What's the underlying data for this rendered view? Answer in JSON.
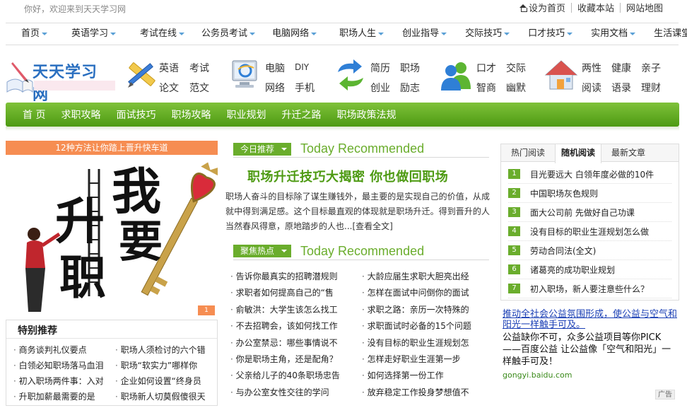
{
  "top": {
    "welcome": "你好，欢迎来到天天学习网",
    "links": [
      "设为首页",
      "收藏本站",
      "网站地图"
    ]
  },
  "nav": [
    "首页",
    "英语学习",
    "考试在线",
    "公务员考试",
    "电脑网络",
    "职场人生",
    "创业指导",
    "交际技巧",
    "口才技巧",
    "实用文档",
    "生活课堂"
  ],
  "brand": {
    "logo_text": "天天学习网",
    "groups": [
      {
        "icon": "pencil-ruler-icon",
        "words": [
          "英语",
          "考试",
          "论文",
          "范文"
        ]
      },
      {
        "icon": "computer-ie-icon",
        "words": [
          "电脑",
          "DIY",
          "网络",
          "手机"
        ]
      },
      {
        "icon": "refresh-arrows-icon",
        "words": [
          "简历",
          "职场",
          "创业",
          "励志"
        ]
      },
      {
        "icon": "people-icon",
        "words": [
          "口才",
          "交际",
          "智商",
          "幽默"
        ]
      },
      {
        "icon": "house-icon",
        "words": [
          "两性",
          "健康",
          "亲子",
          "阅读",
          "语录",
          "理财"
        ]
      }
    ]
  },
  "green_menu": [
    "首 页",
    "求职攻略",
    "面试技巧",
    "职场攻略",
    "职业规划",
    "升迁之路",
    "职场政策法规"
  ],
  "banner": {
    "title": "12种方法让你踏上晋升快车道",
    "chars": [
      "我",
      "要",
      "升",
      "职"
    ]
  },
  "special": {
    "title": "特别推荐",
    "items": [
      "商务谈判礼仪要点",
      "职场人须检讨的六个错",
      "白领必知职场落马血泪",
      "职场“软实力”哪样你",
      "初入职场两件事：入对",
      "企业如何设置“终身员",
      "升职加薪最需要的是",
      "职场新人切莫假傻很天"
    ]
  },
  "today": {
    "tag": "今日推荐",
    "en": "Today Recommended",
    "headline": "职场升迁技巧大揭密  你也做回职场",
    "summary": "职场人奋斗的目标除了谋生赚钱外，最主要的是实现自己的价值，从成就中得到满足感。这个目标最直观的体现就是职场升迁。得到晋升的人当然春风得意，原地踏步的人也...",
    "more": "[查看全文]"
  },
  "hot": {
    "tag": "聚焦热点",
    "en": "Today Recommended",
    "items": [
      "告诉你最真实的招聘潜规则",
      "大龄应届生求职大胆亮出经",
      "求职者如何提高自己的“售",
      "怎样在面试中问倒你的面试",
      "俞敏洪：大学生该怎么找工",
      "求职之路：亲历一次特殊的",
      "不去招聘会，该如何找工作",
      "求职面试时必备的15个问题",
      "办公室禁忌：哪些事情说不",
      "没有目标的职业生涯规划怎",
      "你是职场主角，还是配角？",
      "怎样走好职业生涯第一步",
      "父亲给儿子的40条职场忠告",
      "如何选择第一份工作",
      "与办公室女性交往的学问",
      "放弃稳定工作投身梦想值不"
    ]
  },
  "right": {
    "tabs": [
      "热门阅读",
      "随机阅读",
      "最新文章"
    ],
    "active_tab": 1,
    "rank": [
      {
        "n": "1",
        "t": "目光要远大 白领年度必做的10件"
      },
      {
        "n": "2",
        "t": "中国职场灰色规则"
      },
      {
        "n": "3",
        "t": "面大公司前 先做好自己功课"
      },
      {
        "n": "4",
        "t": "没有目标的职业生涯规划怎么做"
      },
      {
        "n": "5",
        "t": "劳动合同法(全文)"
      },
      {
        "n": "6",
        "t": "诸葛亮的成功职业规划"
      },
      {
        "n": "7",
        "t": "初入职场，新人要注意些什么？"
      }
    ]
  },
  "ad": {
    "link": "推动全社会公益氛围形成，使公益与空气和阳光一样触手可及。",
    "body": "公益缺你不可，众多公益项目等你PICK——百度公益 让公益像「空气和阳光」一样触手可及！",
    "url": "gongyi.baidu.com",
    "tag": "广告"
  },
  "colors": {
    "green": "#6aad2c",
    "orange": "#f68d52",
    "link_blue": "#1a3fb5",
    "logo_blue": "#2a6fc0"
  }
}
